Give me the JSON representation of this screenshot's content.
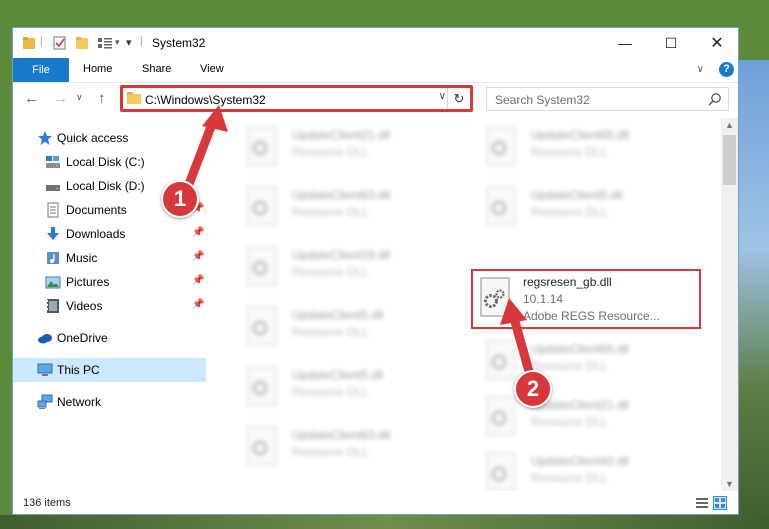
{
  "window": {
    "title": "System32"
  },
  "ribbon": {
    "file": "File",
    "tabs": [
      "Home",
      "Share",
      "View"
    ],
    "help": "?"
  },
  "address": {
    "path": "C:\\Windows\\System32"
  },
  "search": {
    "placeholder": "Search System32"
  },
  "nav": {
    "items": [
      {
        "label": "Quick access",
        "icon": "star-icon"
      },
      {
        "label": "Local Disk (C:)",
        "icon": "drive-icon"
      },
      {
        "label": "Local Disk (D:)",
        "icon": "drive-icon"
      },
      {
        "label": "Documents",
        "icon": "documents-icon"
      },
      {
        "label": "Downloads",
        "icon": "downloads-icon"
      },
      {
        "label": "Music",
        "icon": "music-icon"
      },
      {
        "label": "Pictures",
        "icon": "pictures-icon"
      },
      {
        "label": "Videos",
        "icon": "videos-icon"
      },
      {
        "label": "OneDrive",
        "icon": "cloud-icon"
      },
      {
        "label": "This PC",
        "icon": "computer-icon"
      },
      {
        "label": "Network",
        "icon": "network-icon"
      }
    ]
  },
  "files": {
    "left": [
      {
        "name": "UpdateClient21.dll",
        "type": "Resource DLL"
      },
      {
        "name": "UpdateClient63.dll",
        "type": "Resource DLL"
      },
      {
        "name": "UpdateClient19.dll",
        "type": "Resource DLL"
      },
      {
        "name": "UpdateClient5.dll",
        "type": "Resource DLL"
      },
      {
        "name": "UpdateClient5.dll",
        "type": "Resource DLL"
      },
      {
        "name": "UpdateClient63.dll",
        "type": "Resource DLL"
      }
    ],
    "right": [
      {
        "name": "UpdateClient65.dll",
        "type": "Resource DLL"
      },
      {
        "name": "UpdateClient5.dll",
        "type": "Resource DLL"
      },
      {
        "name": "UpdateClient65.dll",
        "type": "Resource DLL"
      },
      {
        "name": "UpdateClient21.dll",
        "type": "Resource DLL"
      },
      {
        "name": "UpdateClient42.dll",
        "type": "Resource DLL"
      }
    ],
    "highlighted": {
      "name": "regsresen_gb.dll",
      "version": "10.1.14",
      "type": "Adobe REGS Resource..."
    }
  },
  "status": {
    "count": "136 items"
  },
  "annotations": {
    "one": "1",
    "two": "2"
  },
  "colors": {
    "accent": "#1979ca",
    "highlight": "#d9383a",
    "selected": "#cce8ff"
  }
}
